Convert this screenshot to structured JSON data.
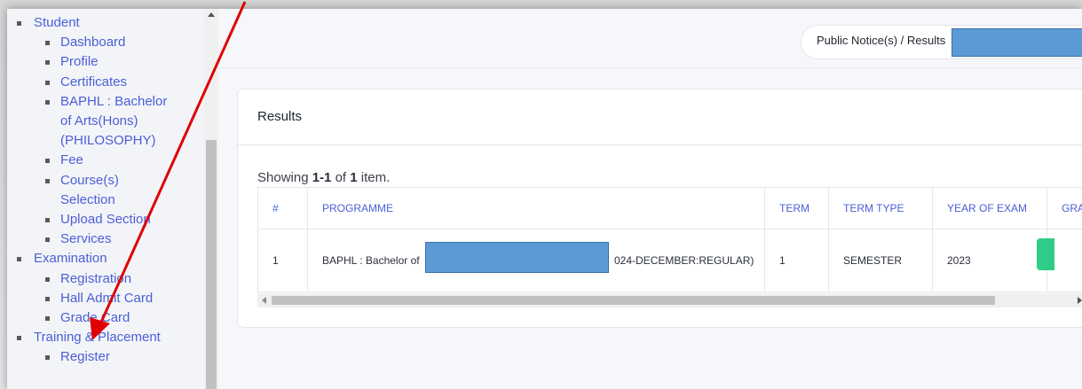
{
  "sidebar": {
    "items": [
      {
        "level": 1,
        "label": "Student"
      },
      {
        "level": 2,
        "label": "Dashboard"
      },
      {
        "level": 2,
        "label": "Profile"
      },
      {
        "level": 2,
        "label": "Certificates"
      },
      {
        "level": 2,
        "label": "BAPHL : Bachelor"
      },
      {
        "level": 0,
        "label": "of Arts(Hons)"
      },
      {
        "level": 0,
        "label": "(PHILOSOPHY)"
      },
      {
        "level": 2,
        "label": "Fee"
      },
      {
        "level": 2,
        "label": "Course(s)"
      },
      {
        "level": 0,
        "label": "Selection"
      },
      {
        "level": 2,
        "label": "Upload Section"
      },
      {
        "level": 2,
        "label": "Services"
      },
      {
        "level": 1,
        "label": "Examination"
      },
      {
        "level": 2,
        "label": "Registration"
      },
      {
        "level": 2,
        "label": "Hall Admit Card"
      },
      {
        "level": 2,
        "label": "Grade Card"
      },
      {
        "level": 1,
        "label": "Training & Placement"
      },
      {
        "level": 2,
        "label": "Register"
      }
    ]
  },
  "header": {
    "breadcrumb": "Public Notice(s) / Results"
  },
  "results": {
    "title": "Results",
    "summary_prefix": "Showing ",
    "summary_range": "1-1",
    "summary_mid": " of ",
    "summary_total": "1",
    "summary_suffix": " item.",
    "columns": [
      "#",
      "PROGRAMME",
      "TERM",
      "TERM TYPE",
      "YEAR OF EXAM",
      "GRA"
    ],
    "rows": [
      {
        "num": "1",
        "programme_start": "BAPHL : Bachelor of",
        "programme_end": "024-DECEMBER:REGULAR)",
        "term": "1",
        "term_type": "SEMESTER",
        "year": "2023"
      }
    ]
  },
  "colors": {
    "link": "#4a5fd6",
    "annotation_arrow": "#e10000",
    "redaction": "#5b9bd5",
    "action_button": "#2ecc87"
  }
}
